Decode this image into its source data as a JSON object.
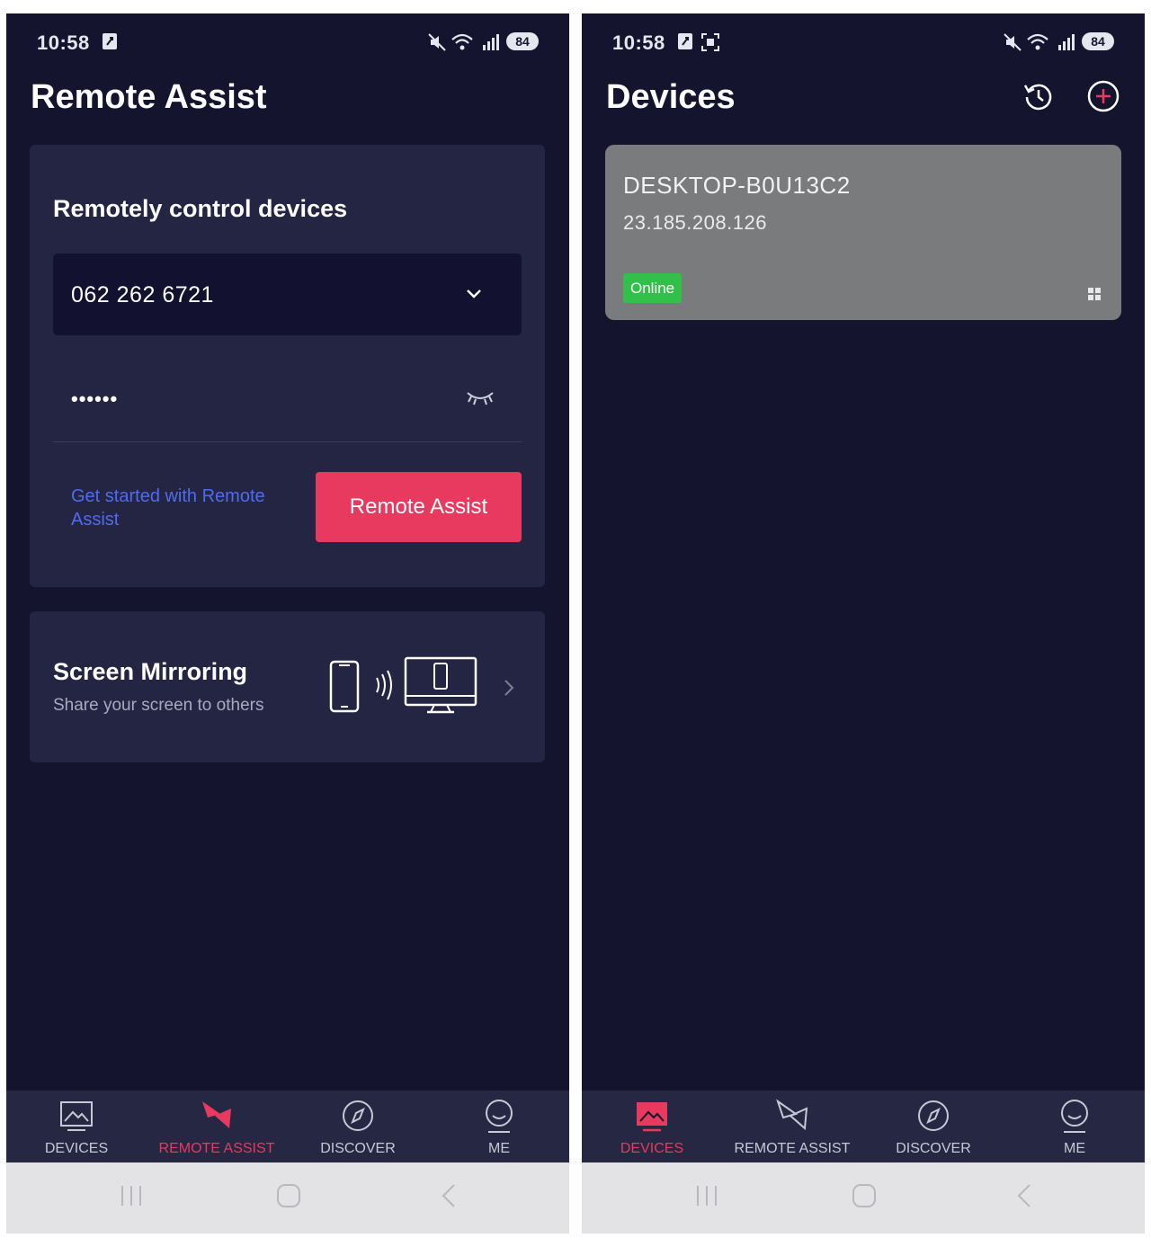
{
  "left_screen": {
    "status": {
      "time": "10:58",
      "battery": "84"
    },
    "title": "Remote Assist",
    "remote_card": {
      "title": "Remotely control devices",
      "device_id": "062 262 6721",
      "password": "••••••",
      "help_link": "Get started with Remote Assist",
      "action_button": "Remote Assist"
    },
    "mirror_card": {
      "title": "Screen Mirroring",
      "subtitle": "Share your screen to others"
    },
    "tabs": [
      {
        "label": "DEVICES",
        "icon": "devices-icon",
        "active": false
      },
      {
        "label": "REMOTE ASSIST",
        "icon": "remote-assist-icon",
        "active": true
      },
      {
        "label": "DISCOVER",
        "icon": "compass-icon",
        "active": false
      },
      {
        "label": "ME",
        "icon": "profile-icon",
        "active": false
      }
    ]
  },
  "right_screen": {
    "status": {
      "time": "10:58",
      "battery": "84"
    },
    "title": "Devices",
    "header_icons": [
      "history-icon",
      "add-icon"
    ],
    "devices": [
      {
        "name": "DESKTOP-B0U13C2",
        "ip": "23.185.208.126",
        "status": "Online",
        "os_icon": "windows-icon"
      }
    ],
    "tabs": [
      {
        "label": "DEVICES",
        "icon": "devices-icon",
        "active": true
      },
      {
        "label": "REMOTE ASSIST",
        "icon": "remote-assist-icon",
        "active": false
      },
      {
        "label": "DISCOVER",
        "icon": "compass-icon",
        "active": false
      },
      {
        "label": "ME",
        "icon": "profile-icon",
        "active": false
      }
    ]
  },
  "colors": {
    "background": "#14142e",
    "card": "#242542",
    "accent": "#e8395e",
    "link": "#4f6bf0",
    "online": "#33c04a",
    "device_card": "#7a7b7c"
  }
}
